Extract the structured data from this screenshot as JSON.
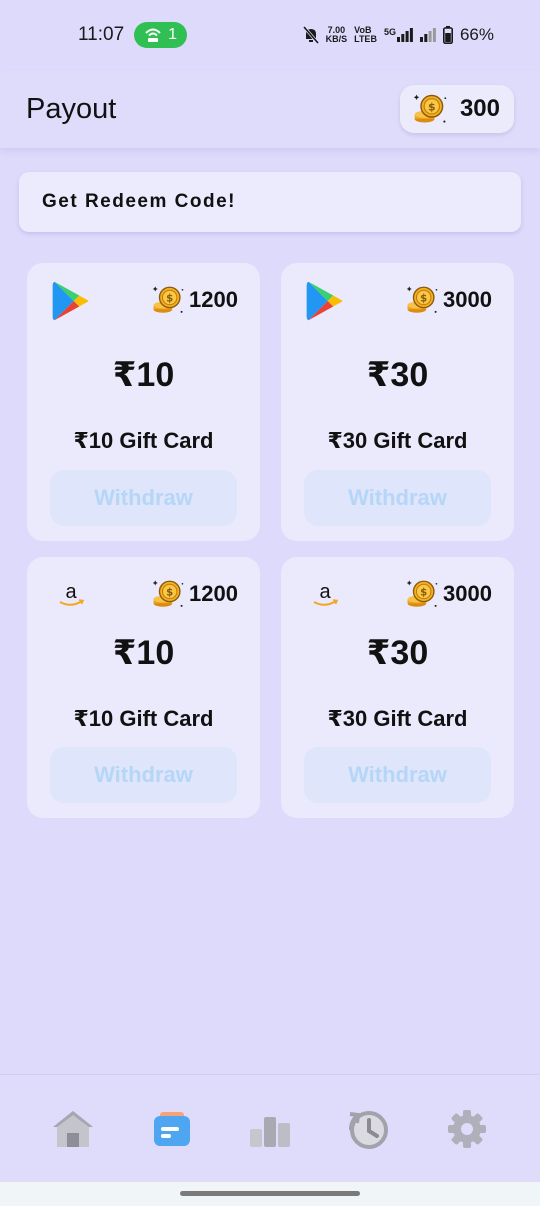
{
  "status_bar": {
    "time": "11:07",
    "hotspot_count": "1",
    "net_speed_value": "7.00",
    "net_speed_unit": "KB/S",
    "volte_top": "VoB",
    "volte_bottom": "LTEB",
    "network": "5G",
    "battery": "66%"
  },
  "header": {
    "title": "Payout",
    "coin_balance": "300"
  },
  "banner": {
    "label": "Get Redeem Code!"
  },
  "cards": [
    {
      "brand": "google-play",
      "cost": "1200",
      "amount": "₹10",
      "name": "₹10 Gift Card",
      "button": "Withdraw"
    },
    {
      "brand": "google-play",
      "cost": "3000",
      "amount": "₹30",
      "name": "₹30 Gift Card",
      "button": "Withdraw"
    },
    {
      "brand": "amazon",
      "cost": "1200",
      "amount": "₹10",
      "name": "₹10 Gift Card",
      "button": "Withdraw"
    },
    {
      "brand": "amazon",
      "cost": "3000",
      "amount": "₹30",
      "name": "₹30 Gift Card",
      "button": "Withdraw"
    }
  ],
  "bottom_nav": {
    "items": [
      {
        "icon": "home-icon",
        "active": false
      },
      {
        "icon": "payout-wallet-icon",
        "active": true
      },
      {
        "icon": "leaderboard-icon",
        "active": false
      },
      {
        "icon": "history-icon",
        "active": false
      },
      {
        "icon": "settings-icon",
        "active": false
      }
    ]
  },
  "amazon_logo_text": "a",
  "colors": {
    "background": "#dedafc",
    "card": "#ebe9fc",
    "button_disabled_bg": "#dfe5fb",
    "button_disabled_text": "#b6d6f7",
    "hotspot_green": "#2fbf52",
    "coin_gold": "#f4b01e",
    "nav_active_blue": "#4ea6f0"
  }
}
